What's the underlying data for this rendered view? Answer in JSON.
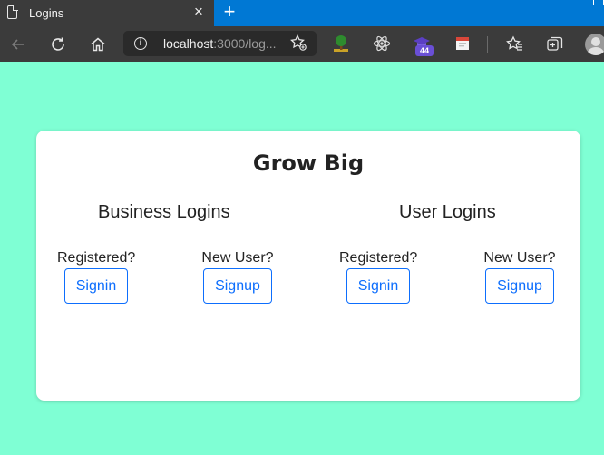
{
  "browser": {
    "tab_title": "Logins",
    "tab_close": "×",
    "new_tab": "+",
    "url_host": "localhost",
    "url_rest": ":3000/log...",
    "extension_badge": "44"
  },
  "page": {
    "title": "Grow Big",
    "sections": [
      {
        "title": "Business Logins",
        "registered_label": "Registered?",
        "signin_label": "Signin",
        "new_user_label": "New User?",
        "signup_label": "Signup"
      },
      {
        "title": "User Logins",
        "registered_label": "Registered?",
        "signin_label": "Signin",
        "new_user_label": "New User?",
        "signup_label": "Signup"
      }
    ]
  },
  "colors": {
    "page_background": "#7fffd4",
    "button_accent": "#0d6efd",
    "tabstrip": "#0078d4",
    "toolbar": "#3b3b3b"
  },
  "icons": [
    "page-icon",
    "back-arrow-icon",
    "reload-icon",
    "home-icon",
    "info-icon",
    "add-favorite-icon",
    "tree-extension-icon",
    "react-extension-icon",
    "graduation-extension-icon",
    "calendar-extension-icon",
    "favorites-icon",
    "collections-icon",
    "profile-avatar-icon"
  ]
}
